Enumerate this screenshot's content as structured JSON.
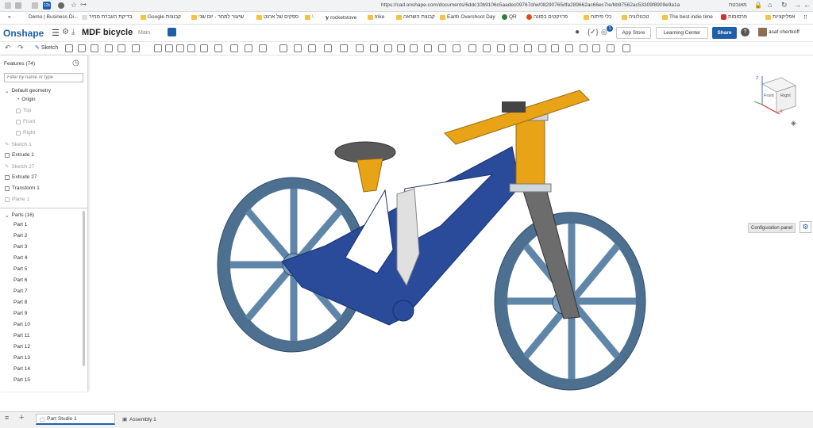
{
  "browser": {
    "url": "https://cad.onshape.com/documents/6ddc10b9106c5aadec09767d/w/08290765dfa289662ac66ec7/e/bb97562ac53309f8909e9a1a",
    "ext_label": "מאובטח",
    "tab_badge": "12k"
  },
  "bookmarks": [
    {
      "label": "Demo | Business Di..."
    },
    {
      "label": "בדיקת העברת מחיר"
    },
    {
      "label": "Google קבוצות"
    },
    {
      "label": "שיעור למחר - יום שני"
    },
    {
      "label": "ספקים של ארגט"
    },
    {
      "label": "rocketstove"
    },
    {
      "label": "trike"
    },
    {
      "label": "קבוצת השראה"
    },
    {
      "label": "Earth Overshoot Day"
    },
    {
      "label": "QR"
    },
    {
      "label": "פרויקטים בסונה"
    },
    {
      "label": "כלי פיתוח"
    },
    {
      "label": "טכנולוגיה"
    },
    {
      "label": "The best indie time"
    },
    {
      "label": "פרסומות"
    },
    {
      "label": "אפליקציות"
    }
  ],
  "app": {
    "logo": "Onshape",
    "doc_title": "MDF bicycle",
    "branch": "Main",
    "notif_count": "1",
    "app_store": "App Store",
    "learning_center": "Learning Center",
    "share": "Share",
    "user": "asaf chertkoff"
  },
  "toolbar": {
    "sketch_label": "Sketch"
  },
  "features": {
    "header": "Features (74)",
    "filter_placeholder": "Filter by name or type",
    "default_geometry": "Default geometry",
    "items": [
      "Origin",
      "Top",
      "Front",
      "Right",
      "Sketch 1",
      "Extrude 1",
      "Sketch 27",
      "Extrude 27",
      "Transform 1",
      "Plane 1"
    ]
  },
  "parts": {
    "header": "Parts (16)",
    "items": [
      "Part 1",
      "Part 2",
      "Part 3",
      "Part 4",
      "Part 5",
      "Part 6",
      "Part 7",
      "Part 8",
      "Part 9",
      "Part 10",
      "Part 11",
      "Part 12",
      "Part 13",
      "Part 14",
      "Part 15"
    ]
  },
  "viewcube": {
    "front": "Front",
    "right": "Right",
    "z": "Z",
    "x": "X"
  },
  "config_panel": "Configuration panel",
  "tabs": {
    "part_studio": "Part Studio 1",
    "assembly": "Assembly 1"
  },
  "colors": {
    "accent": "#1f5fa8",
    "frame": "#2a4a9a",
    "wheel": "#5f86a8",
    "gold": "#e8a317"
  }
}
